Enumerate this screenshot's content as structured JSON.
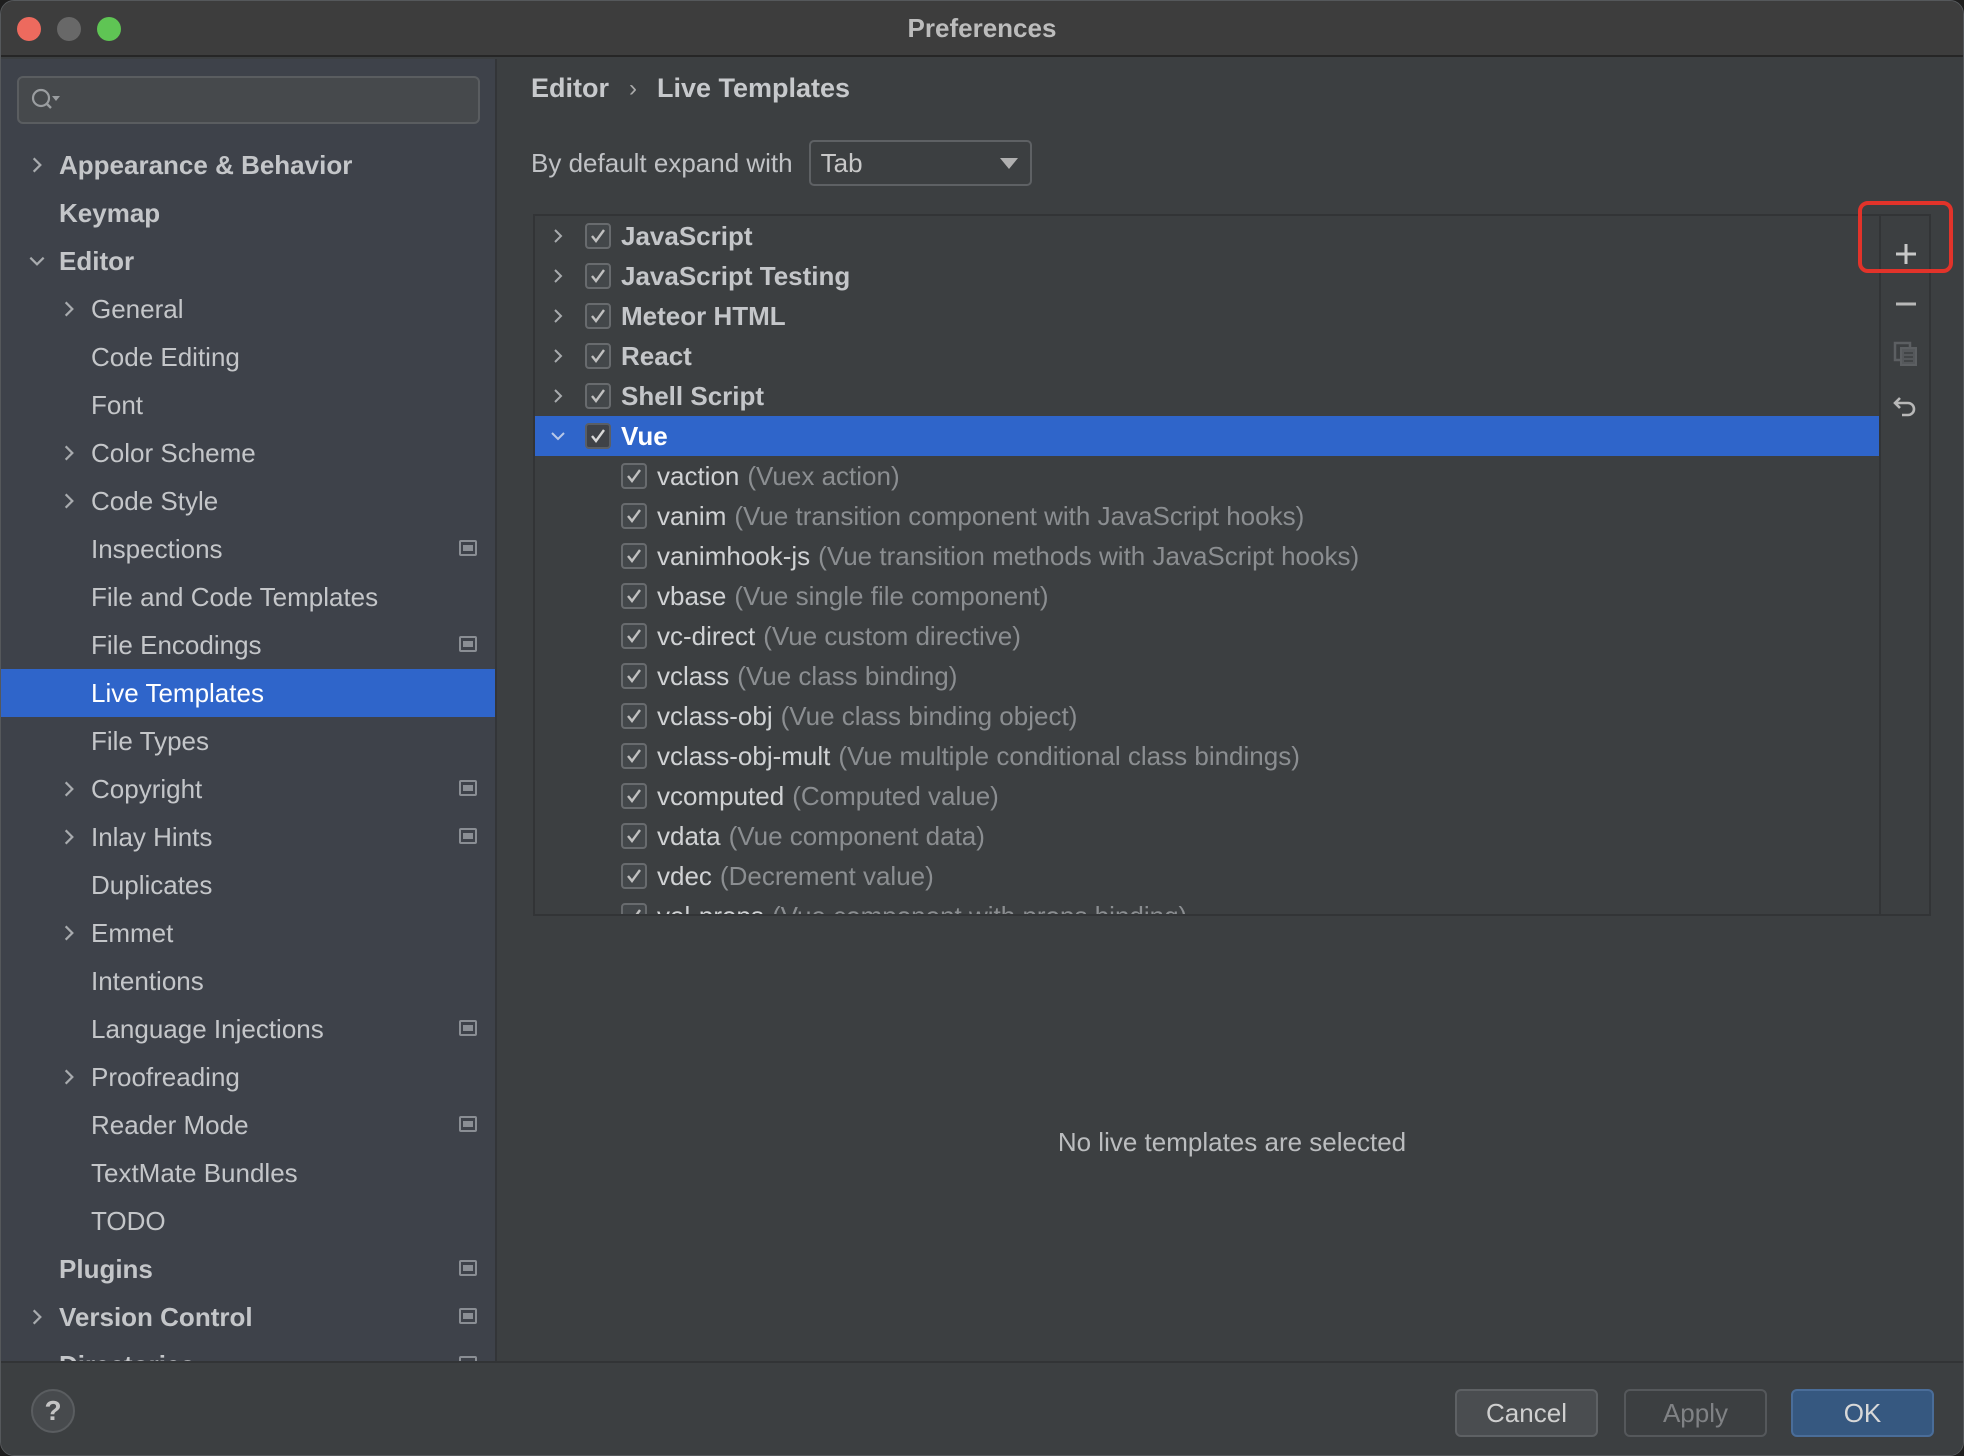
{
  "window": {
    "title": "Preferences"
  },
  "sidebar": {
    "search": {
      "value": "",
      "placeholder": ""
    },
    "items": [
      {
        "label": "Appearance & Behavior",
        "level": 0,
        "chevron": "right",
        "badge": false
      },
      {
        "label": "Keymap",
        "level": 0,
        "chevron": "none",
        "badge": false
      },
      {
        "label": "Editor",
        "level": 0,
        "chevron": "down",
        "badge": false
      },
      {
        "label": "General",
        "level": 1,
        "chevron": "right",
        "badge": false
      },
      {
        "label": "Code Editing",
        "level": 1,
        "chevron": "none",
        "badge": false
      },
      {
        "label": "Font",
        "level": 1,
        "chevron": "none",
        "badge": false
      },
      {
        "label": "Color Scheme",
        "level": 1,
        "chevron": "right",
        "badge": false
      },
      {
        "label": "Code Style",
        "level": 1,
        "chevron": "right",
        "badge": false
      },
      {
        "label": "Inspections",
        "level": 1,
        "chevron": "none",
        "badge": true
      },
      {
        "label": "File and Code Templates",
        "level": 1,
        "chevron": "none",
        "badge": false
      },
      {
        "label": "File Encodings",
        "level": 1,
        "chevron": "none",
        "badge": true
      },
      {
        "label": "Live Templates",
        "level": 1,
        "chevron": "none",
        "badge": false,
        "selected": true
      },
      {
        "label": "File Types",
        "level": 1,
        "chevron": "none",
        "badge": false
      },
      {
        "label": "Copyright",
        "level": 1,
        "chevron": "right",
        "badge": true
      },
      {
        "label": "Inlay Hints",
        "level": 1,
        "chevron": "right",
        "badge": true
      },
      {
        "label": "Duplicates",
        "level": 1,
        "chevron": "none",
        "badge": false
      },
      {
        "label": "Emmet",
        "level": 1,
        "chevron": "right",
        "badge": false
      },
      {
        "label": "Intentions",
        "level": 1,
        "chevron": "none",
        "badge": false
      },
      {
        "label": "Language Injections",
        "level": 1,
        "chevron": "none",
        "badge": true
      },
      {
        "label": "Proofreading",
        "level": 1,
        "chevron": "right",
        "badge": false
      },
      {
        "label": "Reader Mode",
        "level": 1,
        "chevron": "none",
        "badge": true
      },
      {
        "label": "TextMate Bundles",
        "level": 1,
        "chevron": "none",
        "badge": false
      },
      {
        "label": "TODO",
        "level": 1,
        "chevron": "none",
        "badge": false
      },
      {
        "label": "Plugins",
        "level": 0,
        "chevron": "none",
        "badge": true
      },
      {
        "label": "Version Control",
        "level": 0,
        "chevron": "right",
        "badge": true
      },
      {
        "label": "Directories",
        "level": 0,
        "chevron": "none",
        "badge": true
      }
    ]
  },
  "main": {
    "breadcrumb": {
      "parent": "Editor",
      "separator": "›",
      "current": "Live Templates"
    },
    "expand": {
      "label": "By default expand with",
      "selected": "Tab"
    },
    "groups": [
      {
        "name": "JavaScript",
        "checked": true,
        "expanded": false
      },
      {
        "name": "JavaScript Testing",
        "checked": true,
        "expanded": false
      },
      {
        "name": "Meteor HTML",
        "checked": true,
        "expanded": false
      },
      {
        "name": "React",
        "checked": true,
        "expanded": false
      },
      {
        "name": "Shell Script",
        "checked": true,
        "expanded": false
      },
      {
        "name": "Vue",
        "checked": true,
        "expanded": true,
        "selected": true
      }
    ],
    "vue_templates": [
      {
        "abbr": "vaction",
        "desc": "(Vuex action)",
        "checked": true
      },
      {
        "abbr": "vanim",
        "desc": "(Vue transition component with JavaScript hooks)",
        "checked": true
      },
      {
        "abbr": "vanimhook-js",
        "desc": "(Vue transition methods with JavaScript hooks)",
        "checked": true
      },
      {
        "abbr": "vbase",
        "desc": "(Vue single file component)",
        "checked": true
      },
      {
        "abbr": "vc-direct",
        "desc": "(Vue custom directive)",
        "checked": true
      },
      {
        "abbr": "vclass",
        "desc": "(Vue class binding)",
        "checked": true
      },
      {
        "abbr": "vclass-obj",
        "desc": "(Vue class binding object)",
        "checked": true
      },
      {
        "abbr": "vclass-obj-mult",
        "desc": "(Vue multiple conditional class bindings)",
        "checked": true
      },
      {
        "abbr": "vcomputed",
        "desc": "(Computed value)",
        "checked": true
      },
      {
        "abbr": "vdata",
        "desc": "(Vue component data)",
        "checked": true
      },
      {
        "abbr": "vdec",
        "desc": "(Decrement value)",
        "checked": true
      },
      {
        "abbr": "vel-props",
        "desc": "(Vue component with props binding)",
        "checked": true
      }
    ],
    "toolbar": {
      "add": "add-icon",
      "remove": "remove-icon",
      "copy": "copy-icon",
      "restore": "undo-icon"
    },
    "empty_message": "No live templates are selected"
  },
  "footer": {
    "help": "?",
    "cancel": "Cancel",
    "apply": "Apply",
    "ok": "OK"
  },
  "colors": {
    "accent": "#2f65ca",
    "highlight_box": "#e2332a",
    "ok_button": "#365880"
  }
}
